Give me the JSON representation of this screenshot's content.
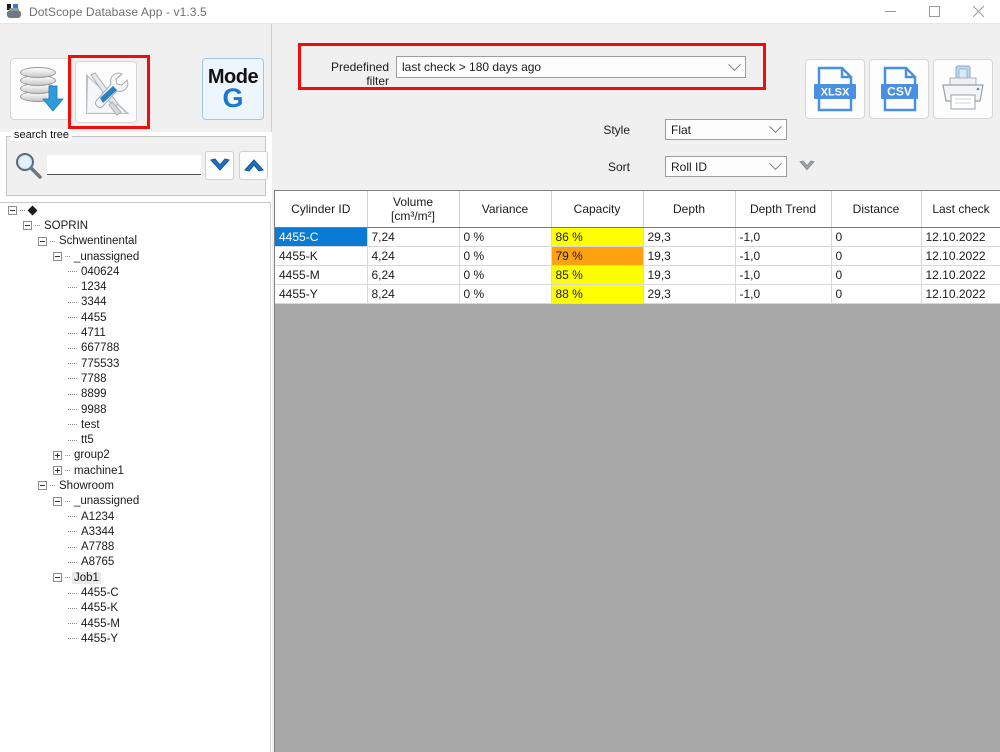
{
  "window": {
    "title": "DotScope Database App - v1.3.5",
    "icon": "dotscope-logo-icon",
    "controls": [
      {
        "name": "minimize-button",
        "glyph": "minimize"
      },
      {
        "name": "maximize-button",
        "glyph": "maximize"
      },
      {
        "name": "close-button",
        "glyph": "close"
      }
    ]
  },
  "toolbar": {
    "database_button_label": "database-download-icon",
    "tools_button_label": "tools-icon",
    "mode_button": {
      "line1": "Mode",
      "line2": "G"
    }
  },
  "search": {
    "group_label": "search tree",
    "input_value": "",
    "placeholder": "",
    "next_button": "find-next-icon",
    "prev_button": "find-previous-icon"
  },
  "tree": {
    "items": [
      {
        "label": "",
        "depth": 0,
        "toggle": "minus",
        "root": true
      },
      {
        "label": "SOPRIN",
        "depth": 1,
        "toggle": "minus"
      },
      {
        "label": "Schwentinental",
        "depth": 2,
        "toggle": "minus"
      },
      {
        "label": "_unassigned",
        "depth": 3,
        "toggle": "minus"
      },
      {
        "label": "040624",
        "depth": 4,
        "toggle": "leaf"
      },
      {
        "label": "1234",
        "depth": 4,
        "toggle": "leaf"
      },
      {
        "label": "3344",
        "depth": 4,
        "toggle": "leaf"
      },
      {
        "label": "4455",
        "depth": 4,
        "toggle": "leaf"
      },
      {
        "label": "4711",
        "depth": 4,
        "toggle": "leaf"
      },
      {
        "label": "667788",
        "depth": 4,
        "toggle": "leaf"
      },
      {
        "label": "775533",
        "depth": 4,
        "toggle": "leaf"
      },
      {
        "label": "7788",
        "depth": 4,
        "toggle": "leaf"
      },
      {
        "label": "8899",
        "depth": 4,
        "toggle": "leaf"
      },
      {
        "label": "9988",
        "depth": 4,
        "toggle": "leaf"
      },
      {
        "label": "test",
        "depth": 4,
        "toggle": "leaf"
      },
      {
        "label": "tt5",
        "depth": 4,
        "toggle": "leaf"
      },
      {
        "label": "group2",
        "depth": 3,
        "toggle": "plus"
      },
      {
        "label": "machine1",
        "depth": 3,
        "toggle": "plus"
      },
      {
        "label": "Showroom",
        "depth": 2,
        "toggle": "minus"
      },
      {
        "label": "_unassigned",
        "depth": 3,
        "toggle": "minus"
      },
      {
        "label": "A1234",
        "depth": 4,
        "toggle": "leaf"
      },
      {
        "label": "A3344",
        "depth": 4,
        "toggle": "leaf"
      },
      {
        "label": "A7788",
        "depth": 4,
        "toggle": "leaf"
      },
      {
        "label": "A8765",
        "depth": 4,
        "toggle": "leaf"
      },
      {
        "label": "Job1",
        "depth": 3,
        "toggle": "minus",
        "selected": true
      },
      {
        "label": "4455-C",
        "depth": 4,
        "toggle": "leaf"
      },
      {
        "label": "4455-K",
        "depth": 4,
        "toggle": "leaf"
      },
      {
        "label": "4455-M",
        "depth": 4,
        "toggle": "leaf"
      },
      {
        "label": "4455-Y",
        "depth": 4,
        "toggle": "leaf"
      }
    ]
  },
  "filters": {
    "predefined_filter_label": "Predefined filter",
    "predefined_filter_value": "last check > 180 days ago",
    "style_label": "Style",
    "style_value": "Flat",
    "sort_label": "Sort",
    "sort_value": "Roll ID",
    "sort_direction_icon": "sort-descending-icon",
    "highlight_color": "#f20d0d"
  },
  "export": {
    "xlsx_label": "XLSX",
    "csv_label": "CSV",
    "print_label": "print-icon"
  },
  "table": {
    "columns": [
      {
        "title": "Cylinder ID",
        "sub": ""
      },
      {
        "title": "Volume",
        "sub": "[cm³/m²]"
      },
      {
        "title": "Variance",
        "sub": ""
      },
      {
        "title": "Capacity",
        "sub": ""
      },
      {
        "title": "Depth",
        "sub": ""
      },
      {
        "title": "Depth Trend",
        "sub": ""
      },
      {
        "title": "Distance",
        "sub": ""
      },
      {
        "title": "Last check",
        "sub": ""
      }
    ],
    "rows": [
      {
        "cylinder_id": "4455-C",
        "selected": true,
        "volume": "7,24",
        "variance": "0 %",
        "capacity": "86 %",
        "capacity_color": "yellow",
        "depth": "29,3",
        "depth_trend": "-1,0",
        "distance": "0",
        "last_check": "12.10.2022"
      },
      {
        "cylinder_id": "4455-K",
        "selected": false,
        "volume": "4,24",
        "variance": "0 %",
        "capacity": "79 %",
        "capacity_color": "orange",
        "depth": "19,3",
        "depth_trend": "-1,0",
        "distance": "0",
        "last_check": "12.10.2022"
      },
      {
        "cylinder_id": "4455-M",
        "selected": false,
        "volume": "6,24",
        "variance": "0 %",
        "capacity": "85 %",
        "capacity_color": "yellow",
        "depth": "19,3",
        "depth_trend": "-1,0",
        "distance": "0",
        "last_check": "12.10.2022"
      },
      {
        "cylinder_id": "4455-Y",
        "selected": false,
        "volume": "8,24",
        "variance": "0 %",
        "capacity": "88 %",
        "capacity_color": "yellow",
        "depth": "29,3",
        "depth_trend": "-1,0",
        "distance": "0",
        "last_check": "12.10.2022"
      }
    ],
    "colors": {
      "selection": "#0a7bd4",
      "capacity_yellow": "#ffff00",
      "capacity_orange": "#ffa212",
      "empty_area": "#a8a8a8"
    }
  }
}
